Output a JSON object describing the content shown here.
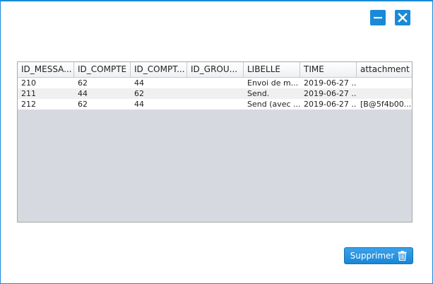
{
  "window": {
    "minimize_icon": "minimize-icon",
    "close_icon": "close-icon",
    "accent_color": "#1a8ad8"
  },
  "table": {
    "columns": [
      "ID_MESSA...",
      "ID_COMPTE",
      "ID_COMPT...",
      "ID_GROU...",
      "LIBELLE",
      "TIME",
      "attachment"
    ],
    "rows": [
      [
        "210",
        "62",
        "44",
        "",
        "Envoi de m...",
        "2019-06-27 ...",
        ""
      ],
      [
        "211",
        "44",
        "62",
        "",
        "Send.",
        "2019-06-27 ...",
        ""
      ],
      [
        "212",
        "62",
        "44",
        "",
        "Send (avec ...",
        "2019-06-27 ...",
        "[B@5f4b00..."
      ]
    ]
  },
  "actions": {
    "delete_label": "Supprimer",
    "delete_icon": "trash-icon"
  }
}
